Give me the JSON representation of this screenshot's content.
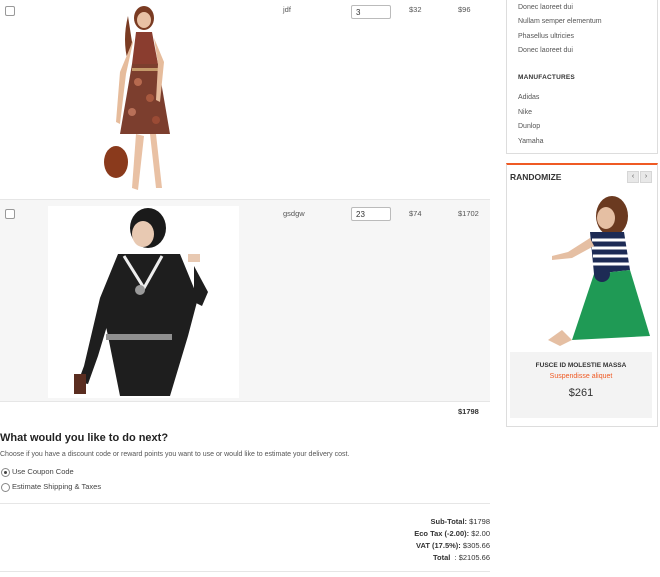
{
  "cart": {
    "rows": [
      {
        "name": "jdf",
        "qty": "3",
        "unit_price": "$32",
        "total": "$96"
      },
      {
        "name": "gsdgw",
        "qty": "23",
        "unit_price": "$74",
        "total": "$1702"
      }
    ],
    "grand_total": "$1798"
  },
  "next": {
    "heading": "What would you like to do next?",
    "description": "Choose if you have a discount code or reward points you want to use or would like to estimate your delivery cost.",
    "options": [
      {
        "label": "Use Coupon Code",
        "selected": true
      },
      {
        "label": "Estimate Shipping & Taxes",
        "selected": false
      }
    ]
  },
  "totals": [
    {
      "label": "Sub-Total:",
      "value": "$1798"
    },
    {
      "label": "Eco Tax (-2.00):",
      "value": "$2.00"
    },
    {
      "label": "VAT (17.5%):",
      "value": "$305.66"
    },
    {
      "label": "Total",
      "value": ": $2105.66"
    }
  ],
  "sidebar": {
    "links": [
      "Donec laoreet dui",
      "Nullam semper elementum",
      "Phasellus ultricies",
      "Donec laoreet dui"
    ],
    "manufactures_heading": "MANUFACTURES",
    "manufactures": [
      "Adidas",
      "Nike",
      "Dunlop",
      "Yamaha"
    ],
    "randomize": {
      "title": "RANDOMIZE",
      "prev_icon": "chevron-left-icon",
      "next_icon": "chevron-right-icon",
      "product_name": "FUSCE ID MOLESTIE MASSA",
      "subtitle": "Suspendisse aliquet",
      "price": "$261"
    }
  },
  "colors": {
    "accent": "#ef5a24",
    "row_alt": "#f6f6f6"
  }
}
